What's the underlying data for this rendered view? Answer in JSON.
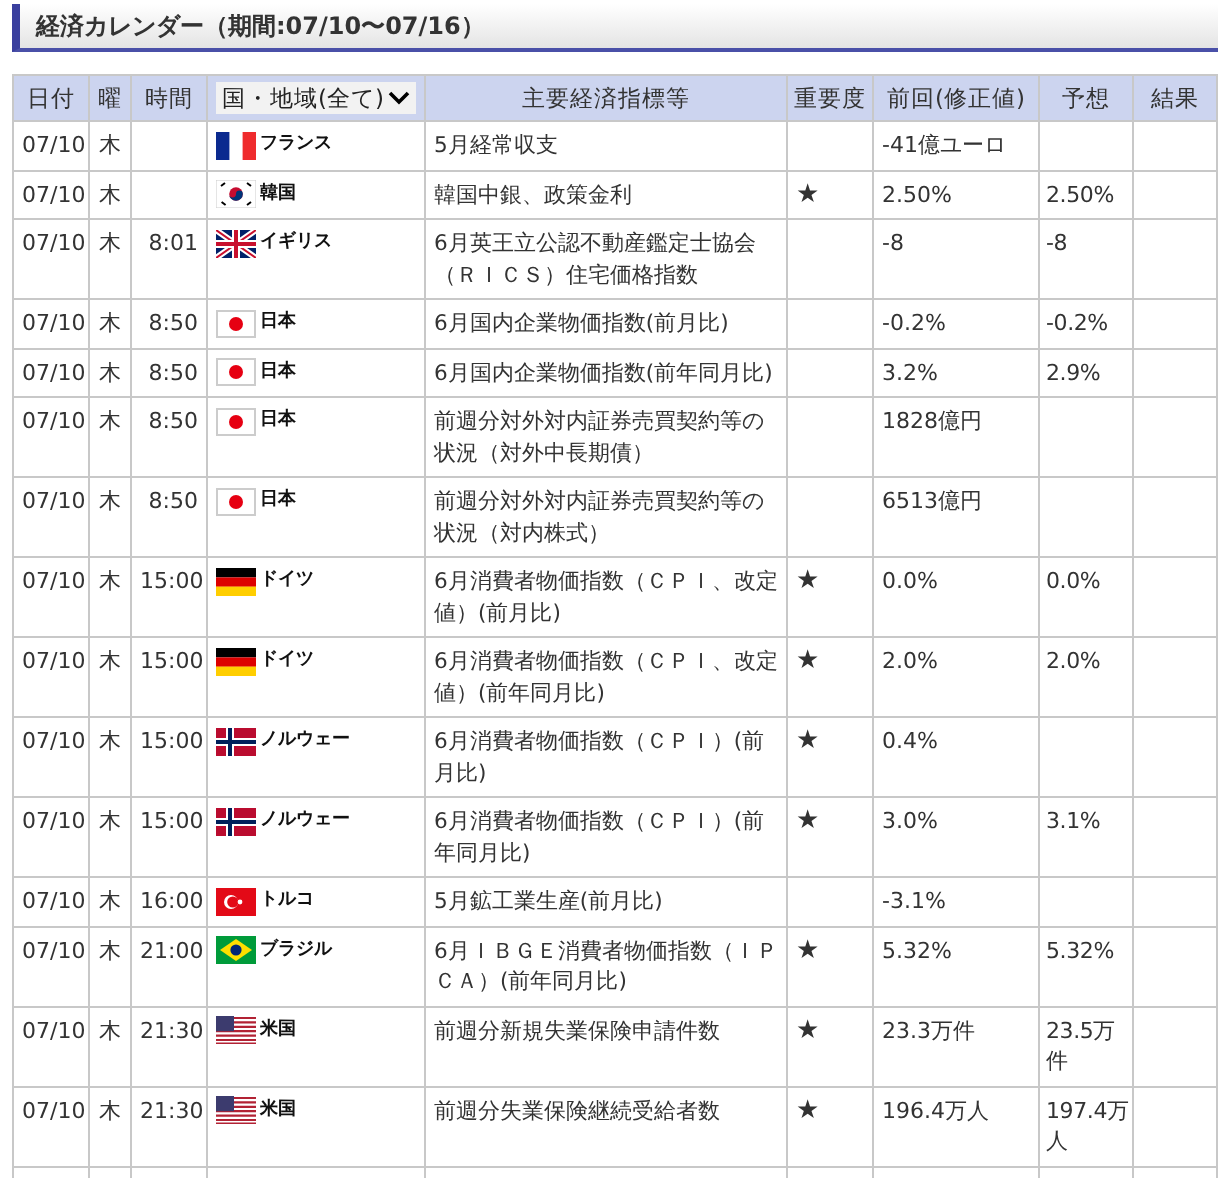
{
  "title": "経済カレンダー（期間:07/10〜07/16）",
  "columns": [
    "日付",
    "曜",
    "時間",
    "国・地域(全て)",
    "主要経済指標等",
    "重要度",
    "前回(修正値)",
    "予想",
    "結果"
  ],
  "rows": [
    {
      "date": "07/10",
      "weekday": "木",
      "kind": "fr",
      "country": "フランス",
      "indicator": "5月経常収支",
      "previous": "-41億ユーロ"
    },
    {
      "date": "07/10",
      "weekday": "木",
      "kind": "kr",
      "country": "韓国",
      "indicator": " 韓国中銀、政策金利",
      "importance": "★",
      "previous": "2.50%",
      "forecast": "2.50%"
    },
    {
      "date": "07/10",
      "weekday": "木",
      "time": "8:01",
      "kind": "gb",
      "country": "イギリス",
      "indicator": "6月英王立公認不動産鑑定士協会（ＲＩＣＳ）住宅価格指数",
      "previous": "-8",
      "forecast": "-8"
    },
    {
      "date": "07/10",
      "weekday": "木",
      "time": "8:50",
      "kind": "jp",
      "country": "日本",
      "indicator": "6月国内企業物価指数(前月比)",
      "previous": "-0.2%",
      "forecast": "-0.2%"
    },
    {
      "date": "07/10",
      "weekday": "木",
      "time": "8:50",
      "kind": "jp",
      "country": "日本",
      "indicator": "6月国内企業物価指数(前年同月比)",
      "previous": "3.2%",
      "forecast": "2.9%"
    },
    {
      "date": "07/10",
      "weekday": "木",
      "time": "8:50",
      "kind": "jp",
      "country": "日本",
      "indicator": "前週分対外対内証券売買契約等の状況（対外中長期債）",
      "previous": "1828億円"
    },
    {
      "date": "07/10",
      "weekday": "木",
      "time": "8:50",
      "kind": "jp",
      "country": "日本",
      "indicator": "前週分対外対内証券売買契約等の状況（対内株式）",
      "previous": "6513億円"
    },
    {
      "date": "07/10",
      "weekday": "木",
      "time": "15:00",
      "kind": "de",
      "country": "ドイツ",
      "indicator": "6月消費者物価指数（ＣＰＩ、改定値）(前月比)",
      "importance": "★",
      "previous": "0.0%",
      "forecast": "0.0%"
    },
    {
      "date": "07/10",
      "weekday": "木",
      "time": "15:00",
      "kind": "de",
      "country": "ドイツ",
      "indicator": "6月消費者物価指数（ＣＰＩ、改定値）(前年同月比)",
      "importance": "★",
      "previous": "2.0%",
      "forecast": "2.0%"
    },
    {
      "date": "07/10",
      "weekday": "木",
      "time": "15:00",
      "kind": "no",
      "country": "ノルウェー",
      "indicator": "6月消費者物価指数（ＣＰＩ）(前月比)",
      "importance": "★",
      "previous": "0.4%"
    },
    {
      "date": "07/10",
      "weekday": "木",
      "time": "15:00",
      "kind": "no",
      "country": "ノルウェー",
      "indicator": "6月消費者物価指数（ＣＰＩ）(前年同月比)",
      "importance": "★",
      "previous": "3.0%",
      "forecast": "3.1%"
    },
    {
      "date": "07/10",
      "weekday": "木",
      "time": "16:00",
      "kind": "tr",
      "country": "トルコ",
      "indicator": "5月鉱工業生産(前月比)",
      "previous": "-3.1%"
    },
    {
      "date": "07/10",
      "weekday": "木",
      "time": "21:00",
      "kind": "br",
      "country": "ブラジル",
      "indicator": "6月ＩＢＧＥ消費者物価指数（ＩＰＣＡ）(前年同月比)",
      "importance": "★",
      "previous": "5.32%",
      "forecast": "5.32%"
    },
    {
      "date": "07/10",
      "weekday": "木",
      "time": "21:30",
      "kind": "us",
      "country": "米国",
      "indicator": "前週分新規失業保険申請件数",
      "importance": "★",
      "previous": "23.3万件",
      "forecast": "23.5万件"
    },
    {
      "date": "07/10",
      "weekday": "木",
      "time": "21:30",
      "kind": "us",
      "country": "米国",
      "indicator": "前週分失業保険継続受給者数",
      "importance": "★",
      "previous": "196.4万人",
      "forecast": "197.4万人"
    }
  ]
}
